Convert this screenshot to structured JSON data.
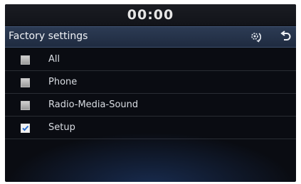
{
  "status_bar": {
    "clock": "00:00"
  },
  "header": {
    "title": "Factory settings",
    "reset_icon": "gear-refresh-icon",
    "back_icon": "back-arrow-icon"
  },
  "options": [
    {
      "label": "All",
      "checked": false
    },
    {
      "label": "Phone",
      "checked": false
    },
    {
      "label": "Radio-Media-Sound",
      "checked": false
    },
    {
      "label": "Setup",
      "checked": true
    }
  ],
  "colors": {
    "header_bg": "#2c3b54",
    "background": "#0a0c12",
    "check_mark": "#2a6fd0"
  }
}
